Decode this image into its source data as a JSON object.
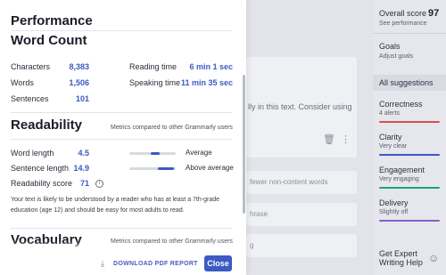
{
  "panel": {
    "title": "Performance",
    "word_count": {
      "heading": "Word Count",
      "rows": [
        {
          "label": "Characters",
          "value": "8,383"
        },
        {
          "label": "Words",
          "value": "1,506"
        },
        {
          "label": "Sentences",
          "value": "101"
        }
      ],
      "reading_time": {
        "label": "Reading time",
        "value": "6 min 1 sec"
      },
      "speaking_time": {
        "label": "Speaking time",
        "value": "11 min 35 sec"
      }
    },
    "readability": {
      "heading": "Readability",
      "note": "Metrics compared to other Grammarly users",
      "word_length": {
        "label": "Word length",
        "value": "4.5",
        "rating": "Average",
        "level": 0.55
      },
      "sentence_length": {
        "label": "Sentence length",
        "value": "14.9",
        "rating": "Above average",
        "level": 0.72
      },
      "score": {
        "label": "Readability score",
        "value": "71"
      },
      "explanation": "Your text is likely to be understood by a reader who has at least a 7th-grade education (age 12) and should be easy for most adults to read."
    },
    "vocabulary": {
      "heading": "Vocabulary",
      "note": "Metrics compared to other Grammarly users"
    },
    "footer": {
      "download_label": "DOWNLOAD PDF REPORT",
      "close_label": "Close"
    }
  },
  "background": {
    "card_text": "lly in this text. Consider using",
    "row1": "fewer non-content words",
    "row2": "hrase",
    "row3": "g"
  },
  "sidebar": {
    "overall_score": {
      "label": "Overall score",
      "value": "97",
      "sub": "See performance"
    },
    "goals": {
      "label": "Goals",
      "sub": "Adjust goals"
    },
    "all_suggestions": "All suggestions",
    "categories": [
      {
        "label": "Correctness",
        "sub": "4 alerts",
        "color": "#d94b52"
      },
      {
        "label": "Clarity",
        "sub": "Very clear",
        "color": "#3b5ac2"
      },
      {
        "label": "Engagement",
        "sub": "Very engaging",
        "color": "#1aa37a"
      },
      {
        "label": "Delivery",
        "sub": "Slightly off",
        "color": "#8b5cc8"
      }
    ],
    "expert": "Get Expert Writing Help"
  }
}
